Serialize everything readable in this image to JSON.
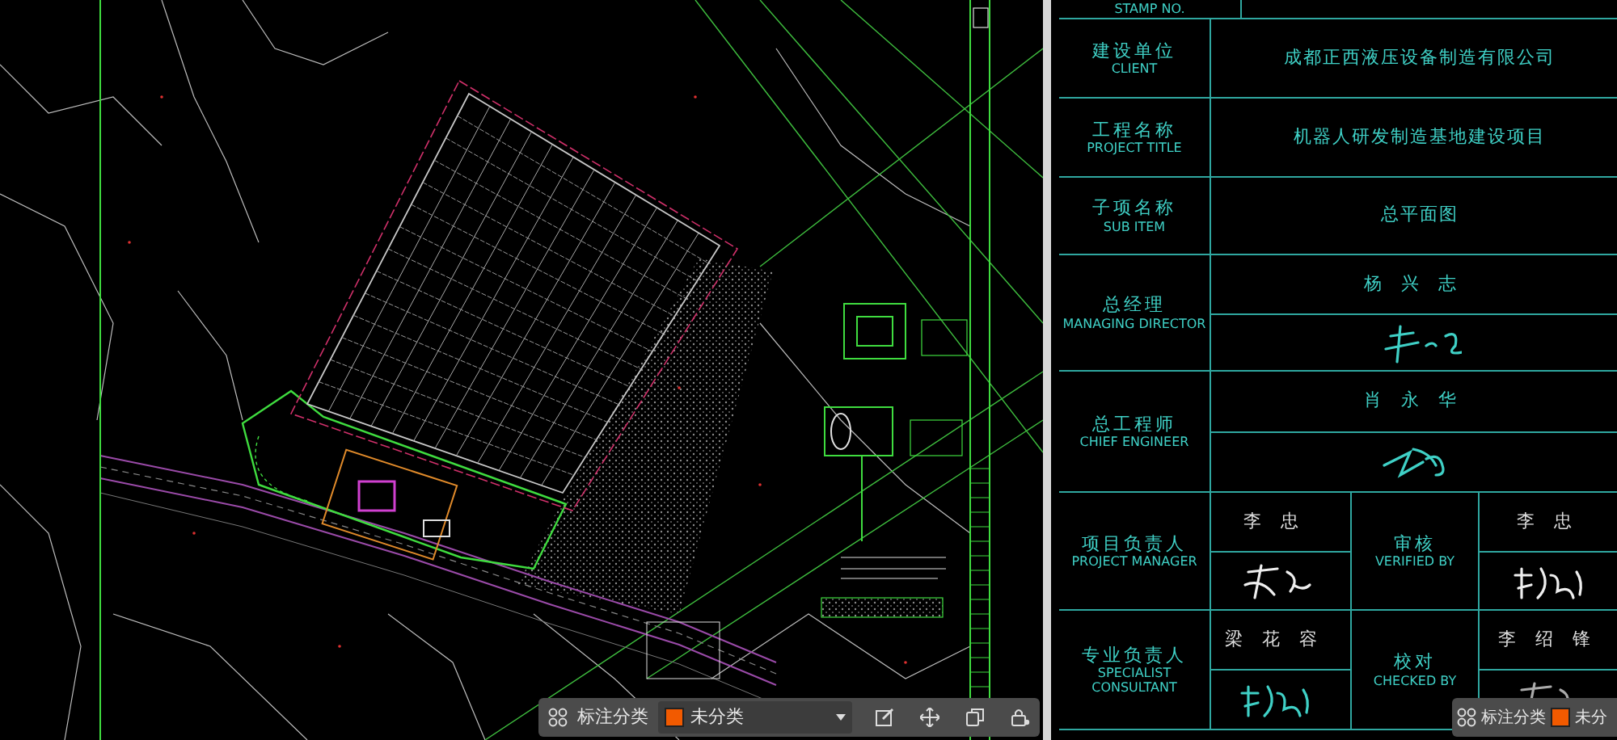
{
  "drawing_panel": {
    "toolbar": {
      "category_label": "标注分类",
      "layer_dropdown": "未分类"
    }
  },
  "title_block": {
    "stamp_label": "STAMP NO.",
    "rows": [
      {
        "label_cn": "建设单位",
        "label_en": "CLIENT",
        "value": "成都正西液压设备制造有限公司"
      },
      {
        "label_cn": "工程名称",
        "label_en": "PROJECT TITLE",
        "value": "机器人研发制造基地建设项目"
      },
      {
        "label_cn": "子项名称",
        "label_en": "SUB ITEM",
        "value": "总平面图"
      }
    ],
    "approvals": [
      {
        "label_cn": "总经理",
        "label_en": "MANAGING DIRECTOR",
        "name": "杨兴志"
      },
      {
        "label_cn": "总工程师",
        "label_en": "CHIEF ENGINEER",
        "name": "肖永华"
      }
    ],
    "pairs": [
      {
        "label_cn": "项目负责人",
        "label_en": "PROJECT MANAGER",
        "name": "李忠",
        "check_label_cn": "审核",
        "check_label_en": "VERIFIED BY",
        "check_name": "李忠"
      },
      {
        "label_cn": "专业负责人",
        "label_en": "SPECIALIST CONSULTANT",
        "name": "梁花容",
        "check_label_cn": "校对",
        "check_label_en": "CHECKED BY",
        "check_name": "李绍锋"
      }
    ]
  },
  "title_toolbar": {
    "category_label": "标注分类",
    "layer_dropdown": "未分"
  }
}
